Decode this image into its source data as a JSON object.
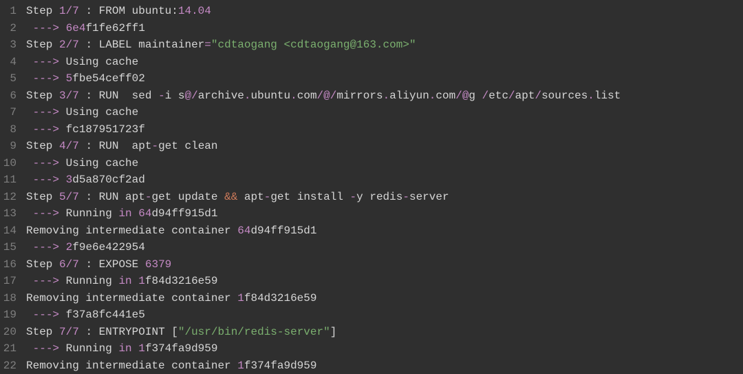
{
  "code_lines": [
    {
      "num": "1",
      "tokens": [
        [
          "plain",
          "Step "
        ],
        [
          "num",
          "1"
        ],
        [
          "slash",
          "/"
        ],
        [
          "num",
          "7"
        ],
        [
          "plain",
          " : FROM ubuntu:"
        ],
        [
          "num",
          "14.04"
        ]
      ]
    },
    {
      "num": "2",
      "tokens": [
        [
          "plain",
          " "
        ],
        [
          "arrow",
          "--->"
        ],
        [
          "plain",
          " "
        ],
        [
          "hash",
          "6e4"
        ],
        [
          "plain",
          "f1fe62ff1"
        ]
      ]
    },
    {
      "num": "3",
      "tokens": [
        [
          "plain",
          "Step "
        ],
        [
          "num",
          "2"
        ],
        [
          "slash",
          "/"
        ],
        [
          "num",
          "7"
        ],
        [
          "plain",
          " : LABEL maintainer"
        ],
        [
          "op",
          "="
        ],
        [
          "str",
          "\"cdtaogang <cdtaogang@163.com>\""
        ]
      ]
    },
    {
      "num": "4",
      "tokens": [
        [
          "plain",
          " "
        ],
        [
          "arrow",
          "--->"
        ],
        [
          "plain",
          " Using cache"
        ]
      ]
    },
    {
      "num": "5",
      "tokens": [
        [
          "plain",
          " "
        ],
        [
          "arrow",
          "--->"
        ],
        [
          "plain",
          " "
        ],
        [
          "hash",
          "5"
        ],
        [
          "plain",
          "fbe54ceff02"
        ]
      ]
    },
    {
      "num": "6",
      "tokens": [
        [
          "plain",
          "Step "
        ],
        [
          "num",
          "3"
        ],
        [
          "slash",
          "/"
        ],
        [
          "num",
          "7"
        ],
        [
          "plain",
          " : RUN  sed "
        ],
        [
          "op",
          "-"
        ],
        [
          "plain",
          "i s"
        ],
        [
          "op",
          "@/"
        ],
        [
          "plain",
          "archive"
        ],
        [
          "op",
          "."
        ],
        [
          "plain",
          "ubuntu"
        ],
        [
          "op",
          "."
        ],
        [
          "plain",
          "com"
        ],
        [
          "op",
          "/@/"
        ],
        [
          "plain",
          "mirrors"
        ],
        [
          "op",
          "."
        ],
        [
          "plain",
          "aliyun"
        ],
        [
          "op",
          "."
        ],
        [
          "plain",
          "com"
        ],
        [
          "op",
          "/@"
        ],
        [
          "plain",
          "g "
        ],
        [
          "op",
          "/"
        ],
        [
          "plain",
          "etc"
        ],
        [
          "op",
          "/"
        ],
        [
          "plain",
          "apt"
        ],
        [
          "op",
          "/"
        ],
        [
          "plain",
          "sources"
        ],
        [
          "op",
          "."
        ],
        [
          "plain",
          "list"
        ]
      ]
    },
    {
      "num": "7",
      "tokens": [
        [
          "plain",
          " "
        ],
        [
          "arrow",
          "--->"
        ],
        [
          "plain",
          " Using cache"
        ]
      ]
    },
    {
      "num": "8",
      "tokens": [
        [
          "plain",
          " "
        ],
        [
          "arrow",
          "--->"
        ],
        [
          "plain",
          " fc187951723f"
        ]
      ]
    },
    {
      "num": "9",
      "tokens": [
        [
          "plain",
          "Step "
        ],
        [
          "num",
          "4"
        ],
        [
          "slash",
          "/"
        ],
        [
          "num",
          "7"
        ],
        [
          "plain",
          " : RUN  apt"
        ],
        [
          "op",
          "-"
        ],
        [
          "plain",
          "get clean"
        ]
      ]
    },
    {
      "num": "10",
      "tokens": [
        [
          "plain",
          " "
        ],
        [
          "arrow",
          "--->"
        ],
        [
          "plain",
          " Using cache"
        ]
      ]
    },
    {
      "num": "11",
      "tokens": [
        [
          "plain",
          " "
        ],
        [
          "arrow",
          "--->"
        ],
        [
          "plain",
          " "
        ],
        [
          "hash",
          "3"
        ],
        [
          "plain",
          "d5a870cf2ad"
        ]
      ]
    },
    {
      "num": "12",
      "tokens": [
        [
          "plain",
          "Step "
        ],
        [
          "num",
          "5"
        ],
        [
          "slash",
          "/"
        ],
        [
          "num",
          "7"
        ],
        [
          "plain",
          " : RUN apt"
        ],
        [
          "op",
          "-"
        ],
        [
          "plain",
          "get update "
        ],
        [
          "amp",
          "&&"
        ],
        [
          "plain",
          " apt"
        ],
        [
          "op",
          "-"
        ],
        [
          "plain",
          "get install "
        ],
        [
          "op",
          "-"
        ],
        [
          "plain",
          "y redis"
        ],
        [
          "op",
          "-"
        ],
        [
          "plain",
          "server"
        ]
      ]
    },
    {
      "num": "13",
      "tokens": [
        [
          "plain",
          " "
        ],
        [
          "arrow",
          "--->"
        ],
        [
          "plain",
          " Running "
        ],
        [
          "op",
          "in"
        ],
        [
          "plain",
          " "
        ],
        [
          "hash",
          "64"
        ],
        [
          "plain",
          "d94ff915d1"
        ]
      ]
    },
    {
      "num": "14",
      "tokens": [
        [
          "plain",
          "Removing intermediate container "
        ],
        [
          "hash",
          "64"
        ],
        [
          "plain",
          "d94ff915d1"
        ]
      ]
    },
    {
      "num": "15",
      "tokens": [
        [
          "plain",
          " "
        ],
        [
          "arrow",
          "--->"
        ],
        [
          "plain",
          " "
        ],
        [
          "hash",
          "2"
        ],
        [
          "plain",
          "f9e6e422954"
        ]
      ]
    },
    {
      "num": "16",
      "tokens": [
        [
          "plain",
          "Step "
        ],
        [
          "num",
          "6"
        ],
        [
          "slash",
          "/"
        ],
        [
          "num",
          "7"
        ],
        [
          "plain",
          " : EXPOSE "
        ],
        [
          "num",
          "6379"
        ]
      ]
    },
    {
      "num": "17",
      "tokens": [
        [
          "plain",
          " "
        ],
        [
          "arrow",
          "--->"
        ],
        [
          "plain",
          " Running "
        ],
        [
          "op",
          "in"
        ],
        [
          "plain",
          " "
        ],
        [
          "hash",
          "1"
        ],
        [
          "plain",
          "f84d3216e59"
        ]
      ]
    },
    {
      "num": "18",
      "tokens": [
        [
          "plain",
          "Removing intermediate container "
        ],
        [
          "hash",
          "1"
        ],
        [
          "plain",
          "f84d3216e59"
        ]
      ]
    },
    {
      "num": "19",
      "tokens": [
        [
          "plain",
          " "
        ],
        [
          "arrow",
          "--->"
        ],
        [
          "plain",
          " f37a8fc441e5"
        ]
      ]
    },
    {
      "num": "20",
      "tokens": [
        [
          "plain",
          "Step "
        ],
        [
          "num",
          "7"
        ],
        [
          "slash",
          "/"
        ],
        [
          "num",
          "7"
        ],
        [
          "plain",
          " : ENTRYPOINT "
        ],
        [
          "punc",
          "["
        ],
        [
          "str",
          "\"/usr/bin/redis-server\""
        ],
        [
          "punc",
          "]"
        ]
      ]
    },
    {
      "num": "21",
      "tokens": [
        [
          "plain",
          " "
        ],
        [
          "arrow",
          "--->"
        ],
        [
          "plain",
          " Running "
        ],
        [
          "op",
          "in"
        ],
        [
          "plain",
          " "
        ],
        [
          "hash",
          "1"
        ],
        [
          "plain",
          "f374fa9d959"
        ]
      ]
    },
    {
      "num": "22",
      "tokens": [
        [
          "plain",
          "Removing intermediate container "
        ],
        [
          "hash",
          "1"
        ],
        [
          "plain",
          "f374fa9d959"
        ]
      ]
    }
  ]
}
